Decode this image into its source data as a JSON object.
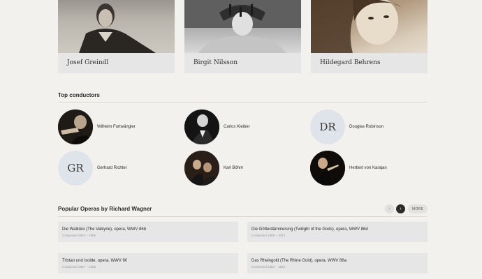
{
  "singers": [
    {
      "name": "Josef Greindl"
    },
    {
      "name": "Birgit Nilsson"
    },
    {
      "name": "Hildegard Behrens"
    }
  ],
  "conductors_section": {
    "title": "Top conductors",
    "items": [
      {
        "name": "Wilhelm Furtwängler",
        "initials": "",
        "avatar": "photo"
      },
      {
        "name": "Carlos Kleiber",
        "initials": "",
        "avatar": "photo"
      },
      {
        "name": "Douglas Robinson",
        "initials": "DR",
        "avatar": "initials"
      },
      {
        "name": "Gerhard Richter",
        "initials": "GR",
        "avatar": "initials"
      },
      {
        "name": "Karl Böhm",
        "initials": "",
        "avatar": "photo"
      },
      {
        "name": "Herbert von Karajan",
        "initials": "",
        "avatar": "photo"
      }
    ]
  },
  "operas_section": {
    "title": "Popular Operas by Richard Wagner",
    "prev_icon": "chevron-left-icon",
    "next_icon": "chevron-right-icon",
    "prev_glyph": "‹",
    "next_glyph": "›",
    "more_label": "MORE",
    "items": [
      {
        "title": "Die Walküre (The Valkyrie), opera, WWV 86b",
        "composed": "Composed 1854 – 1856"
      },
      {
        "title": "Die Götterdämmerung (Twilight of the Gods), opera, WWV 86d",
        "composed": "Composed 1869 – 1874"
      },
      {
        "title": "Tristan und Isolde, opera, WWV 90",
        "composed": "Composed 1857 – 1859"
      },
      {
        "title": "Das Rheingold (The Rhine Gold), opera, WWV 86a",
        "composed": "Composed 1853 – 1854"
      }
    ]
  },
  "colors": {
    "background": "#f3f1ee",
    "card": "#e6e6e6",
    "initials_avatar": "#dfe3ea",
    "accent_dark": "#2b2b2b"
  }
}
